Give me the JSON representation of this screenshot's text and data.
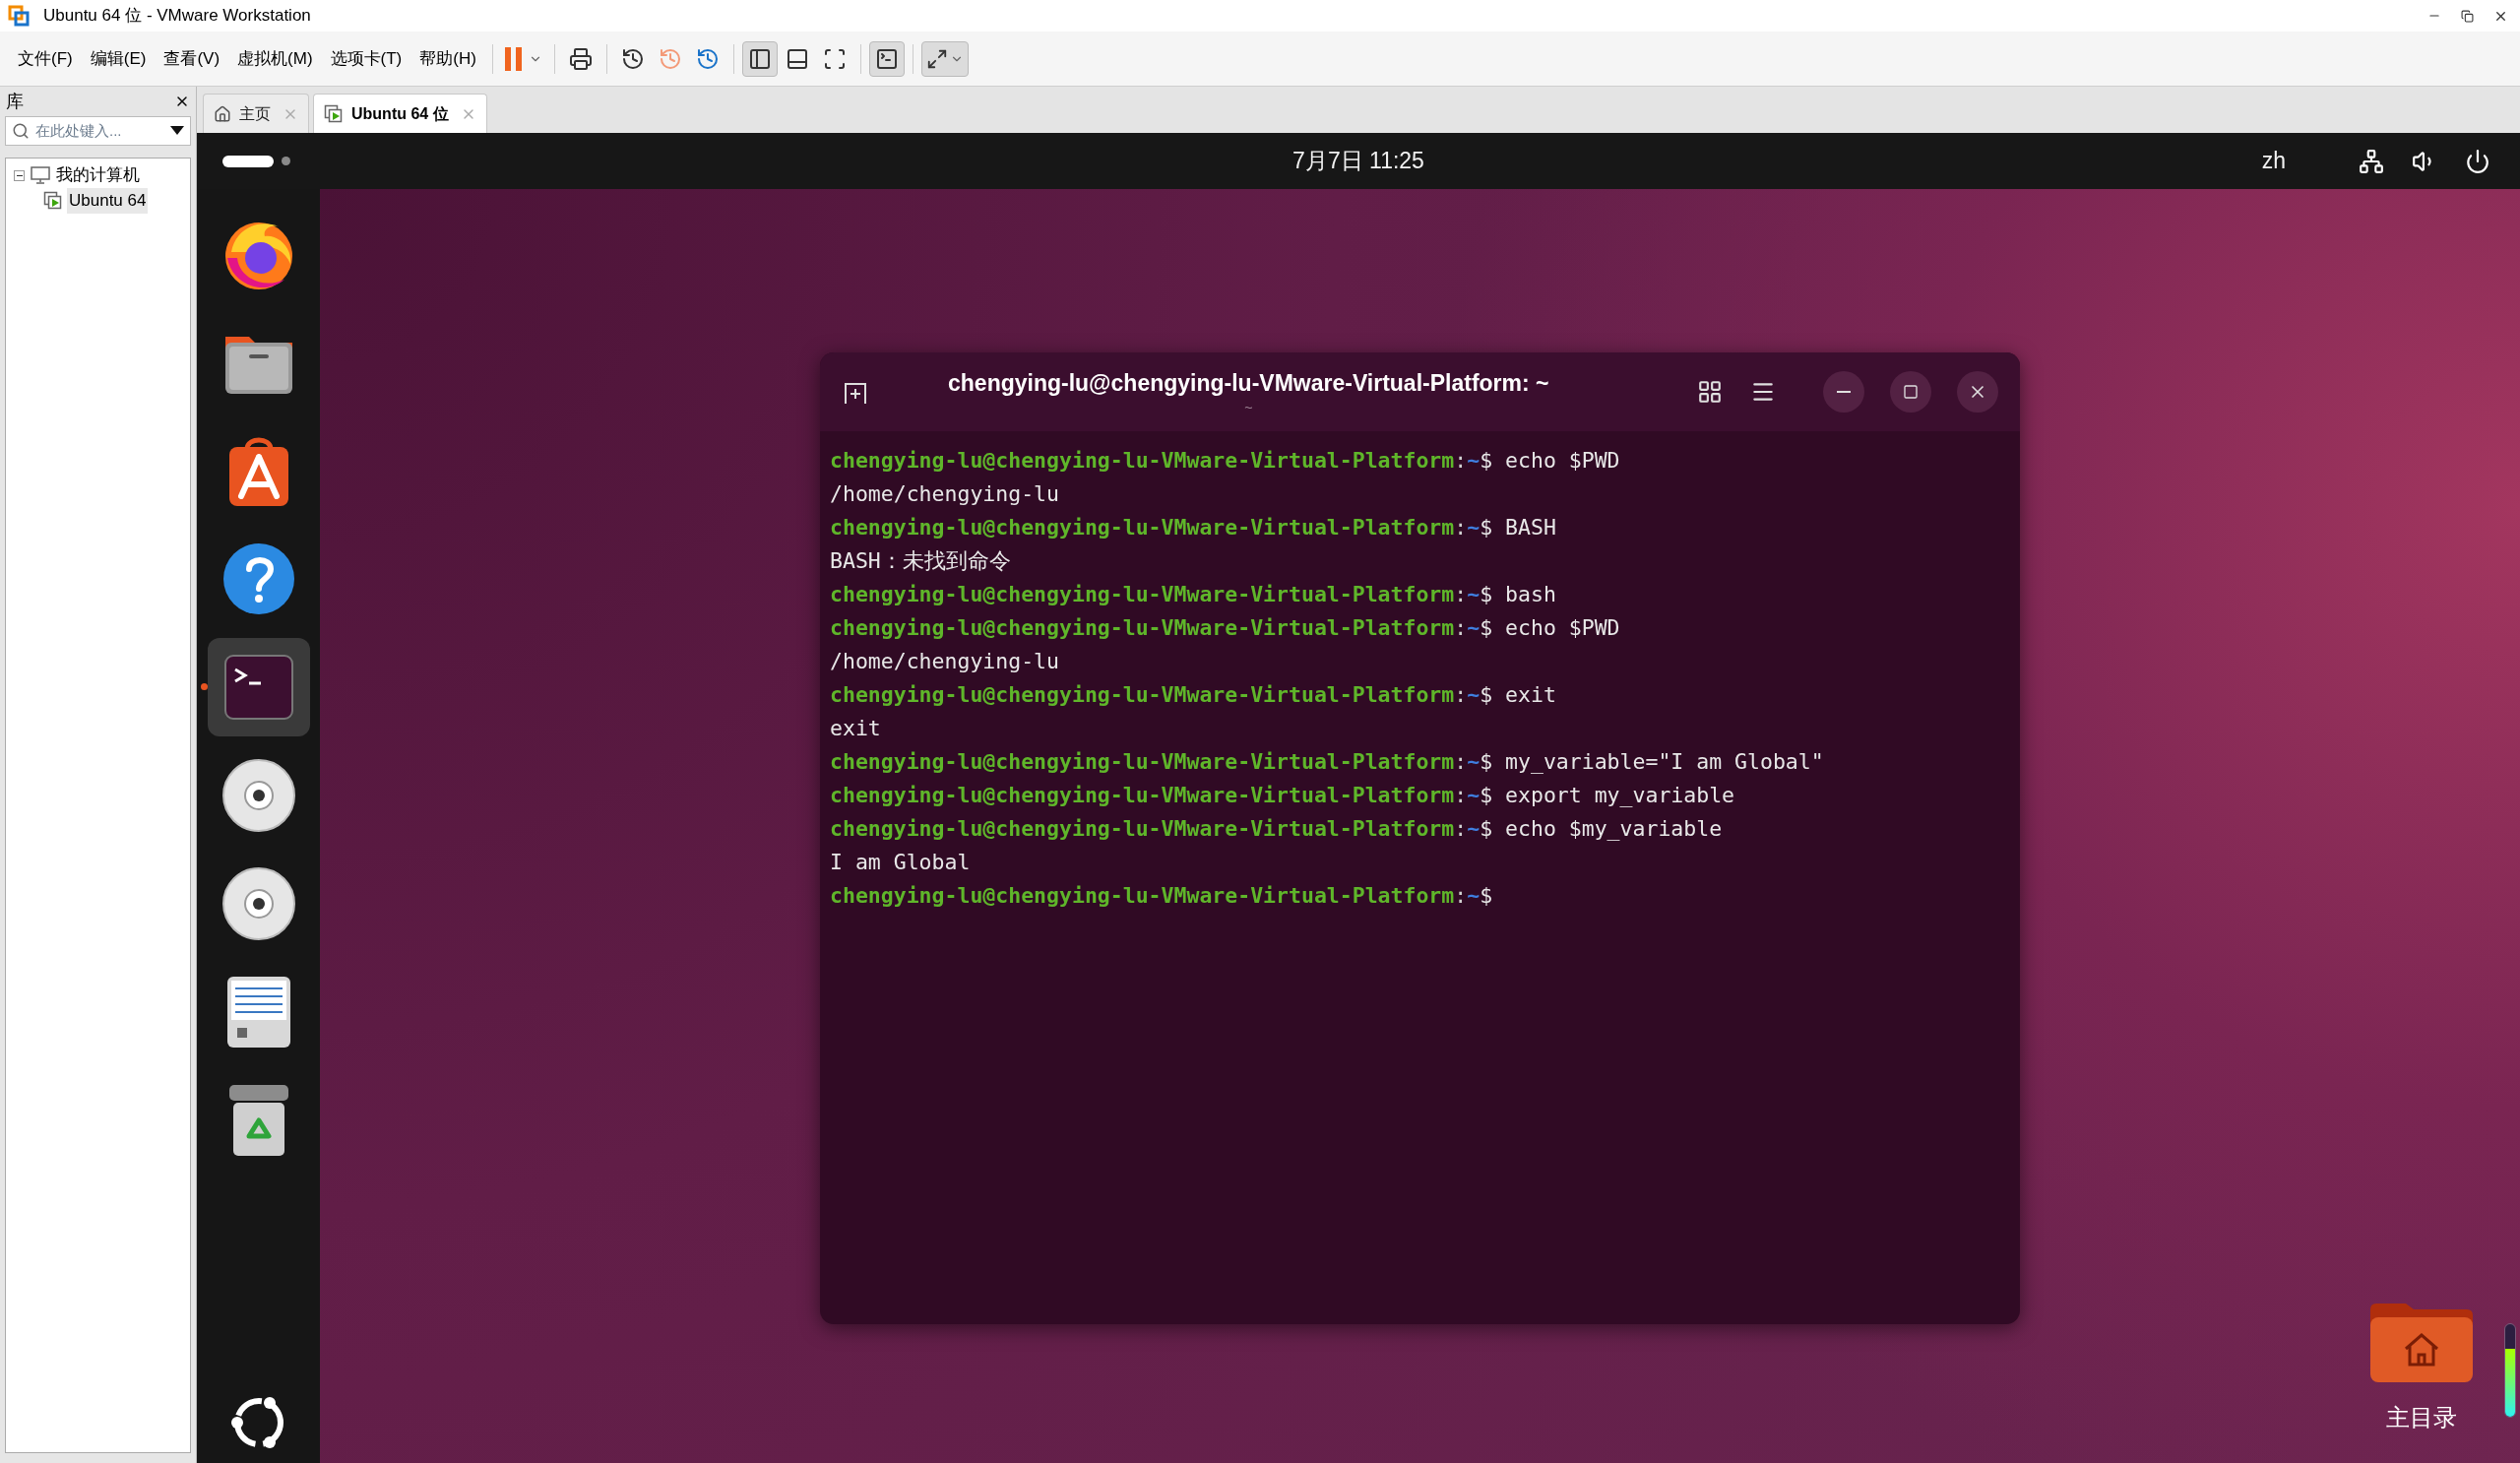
{
  "window": {
    "title": "Ubuntu 64 位 - VMware Workstation"
  },
  "menu": [
    "文件(F)",
    "编辑(E)",
    "查看(V)",
    "虚拟机(M)",
    "选项卡(T)",
    "帮助(H)"
  ],
  "library": {
    "title": "库",
    "search": {
      "placeholder": "在此处键入..."
    },
    "tree": [
      {
        "label": "我的计算机",
        "expanded": true,
        "children": [
          {
            "label": "Ubuntu 64",
            "selected": true
          }
        ]
      }
    ]
  },
  "tabs": [
    {
      "label": "主页",
      "selected": false
    },
    {
      "label": "Ubuntu 64 位",
      "selected": true
    }
  ],
  "top_bar": {
    "clock": "7月7日 11:25",
    "language": "zh"
  },
  "dock": [
    {
      "kind": "browser",
      "running": false
    },
    {
      "kind": "files",
      "running": false
    },
    {
      "kind": "store",
      "running": false
    },
    {
      "kind": "help",
      "running": false
    },
    {
      "kind": "terminal",
      "running": true
    },
    {
      "kind": "disc",
      "running": false
    },
    {
      "kind": "disc",
      "running": false
    },
    {
      "kind": "editor",
      "running": false
    },
    {
      "kind": "trash",
      "running": false
    }
  ],
  "terminal": {
    "title": "chengying-lu@chengying-lu-VMware-Virtual-Platform: ~",
    "subtitle": "~",
    "lines": [
      {
        "kind": "prompt",
        "host": "chengying-lu@chengying-lu-VMware-Virtual-Platform",
        "colon": ":",
        "path": "~",
        "symbol": "$",
        "command": "echo $PWD"
      },
      {
        "kind": "output",
        "text": "/home/chengying-lu"
      },
      {
        "kind": "prompt",
        "host": "chengying-lu@chengying-lu-VMware-Virtual-Platform",
        "colon": ":",
        "path": "~",
        "symbol": "$",
        "command": "BASH"
      },
      {
        "kind": "output",
        "text": "BASH：未找到命令"
      },
      {
        "kind": "prompt",
        "host": "chengying-lu@chengying-lu-VMware-Virtual-Platform",
        "colon": ":",
        "path": "~",
        "symbol": "$",
        "command": "bash"
      },
      {
        "kind": "prompt",
        "host": "chengying-lu@chengying-lu-VMware-Virtual-Platform",
        "colon": ":",
        "path": "~",
        "symbol": "$",
        "command": "echo $PWD"
      },
      {
        "kind": "output",
        "text": "/home/chengying-lu"
      },
      {
        "kind": "prompt",
        "host": "chengying-lu@chengying-lu-VMware-Virtual-Platform",
        "colon": ":",
        "path": "~",
        "symbol": "$",
        "command": "exit"
      },
      {
        "kind": "output",
        "text": "exit"
      },
      {
        "kind": "prompt",
        "host": "chengying-lu@chengying-lu-VMware-Virtual-Platform",
        "colon": ":",
        "path": "~",
        "symbol": "$",
        "command": "my_variable=\"I am Global\""
      },
      {
        "kind": "prompt",
        "host": "chengying-lu@chengying-lu-VMware-Virtual-Platform",
        "colon": ":",
        "path": "~",
        "symbol": "$",
        "command": "export my_variable"
      },
      {
        "kind": "prompt",
        "host": "chengying-lu@chengying-lu-VMware-Virtual-Platform",
        "colon": ":",
        "path": "~",
        "symbol": "$",
        "command": "echo $my_variable"
      },
      {
        "kind": "output",
        "text": "I am Global"
      },
      {
        "kind": "prompt",
        "host": "chengying-lu@chengying-lu-VMware-Virtual-Platform",
        "colon": ":",
        "path": "~",
        "symbol": "$"
      }
    ]
  },
  "desktop_icons": [
    {
      "label": "主目录"
    }
  ],
  "meter": {
    "level": 0.73
  }
}
